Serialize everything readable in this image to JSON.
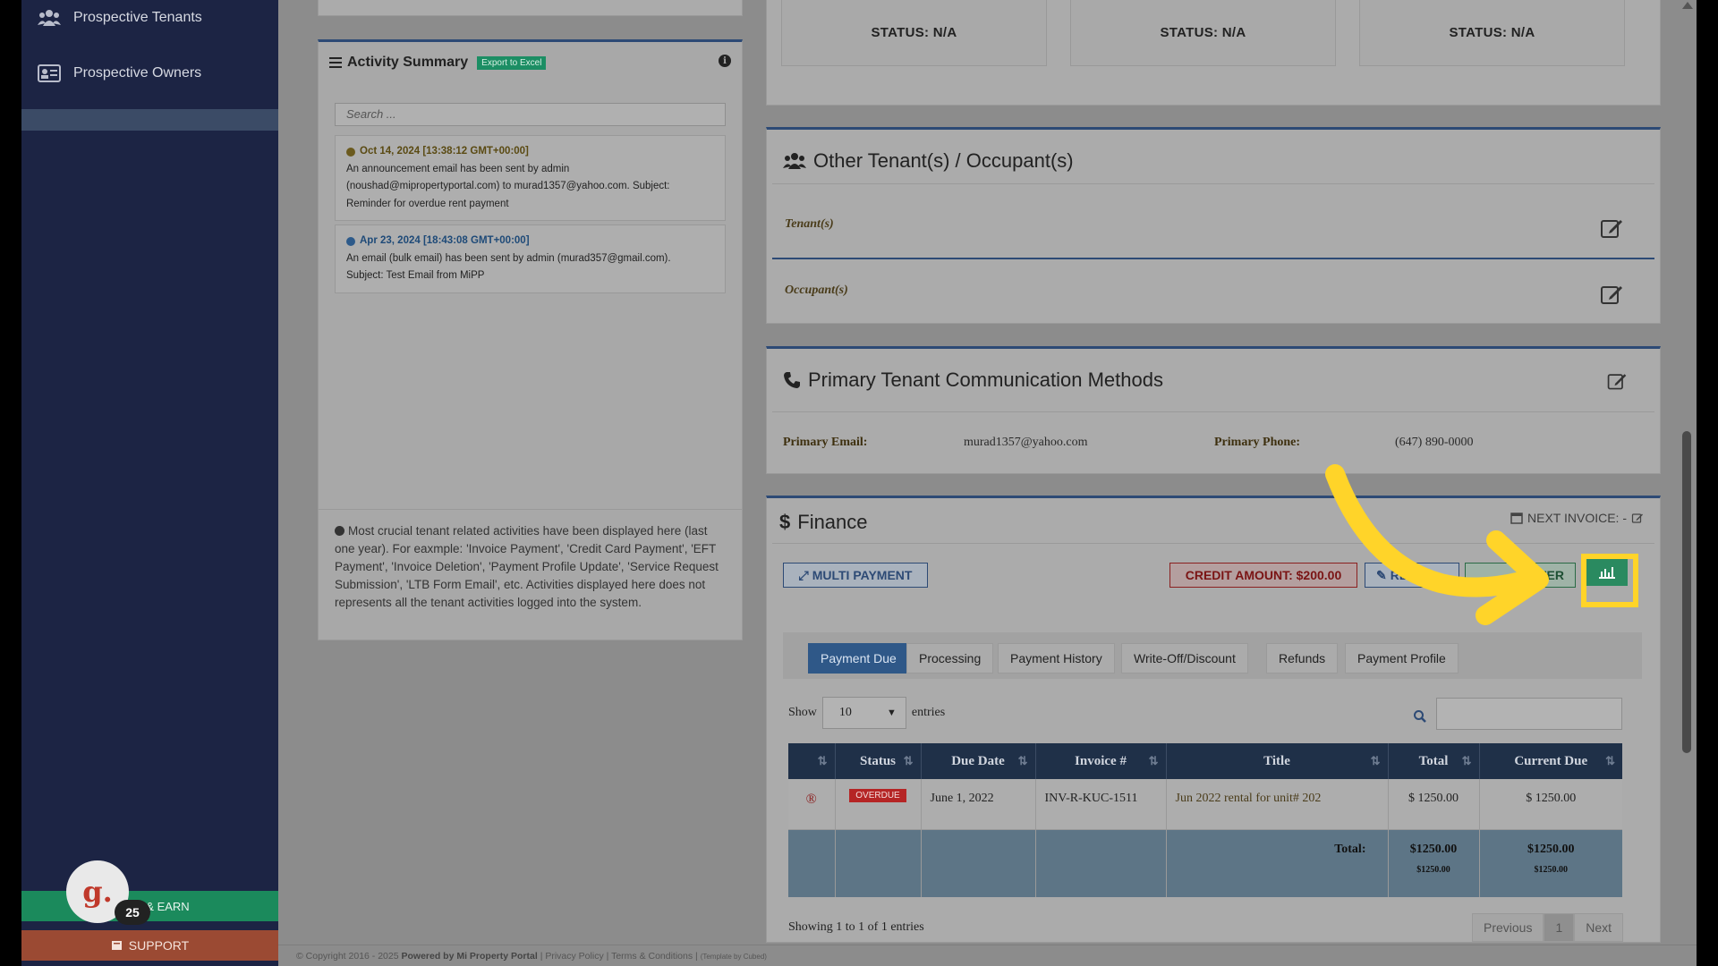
{
  "sidebar": {
    "items": [
      {
        "label": "Prospective Tenants",
        "icon": "users-icon"
      },
      {
        "label": "Prospective Owners",
        "icon": "id-card-icon"
      }
    ],
    "refer_label": "& EARN",
    "support_label": "SUPPORT",
    "notification_letter": "g.",
    "notification_count": "25"
  },
  "statuses": [
    "STATUS: N/A",
    "STATUS: N/A",
    "STATUS: N/A"
  ],
  "activity": {
    "title": "Activity Summary",
    "export_label": "Export to Excel",
    "search_placeholder": "Search ...",
    "items": [
      {
        "date": "Oct 14, 2024 [13:38:12 GMT+00:00]",
        "dot_color": "#6b5a1e",
        "line1": "An announcement email has been sent by admin",
        "line2": "(noushad@mipropertyportal.com) to murad1357@yahoo.com. Subject:",
        "line3": "Reminder for overdue rent payment"
      },
      {
        "date": "Apr 23, 2024 [18:43:08 GMT+00:00]",
        "dot_color": "#2d5a8a",
        "line1": "An email (bulk email) has been sent by admin (murad357@gmail.com).",
        "line2": "Subject: Test Email from MiPP"
      }
    ],
    "note": "Most crucial tenant related activities have been displayed here (last one year). For eaxmple: 'Invoice Payment', 'Credit Card Payment', 'EFT Payment', 'Invoice Deletion', 'Payment Profile Update', 'Service Request Submission', 'LTB Form Email', etc. Activities displayed here does not represents all the tenant activities logged into the system."
  },
  "tenants": {
    "title": "Other Tenant(s) / Occupant(s)",
    "tenant_label": "Tenant(s)",
    "occupant_label": "Occupant(s)"
  },
  "communication": {
    "title": "Primary Tenant Communication Methods",
    "email_label": "Primary Email:",
    "email_value": "murad1357@yahoo.com",
    "phone_label": "Primary Phone:",
    "phone_value": "(647) 890-0000"
  },
  "finance": {
    "title": "Finance",
    "next_invoice": "NEXT INVOICE: -",
    "multi_payment": "MULTI PAYMENT",
    "credit_amount": "CREDIT AMOUNT: $200.00",
    "return_label": "RETUR",
    "offer_label": "FER",
    "tabs": [
      "Payment Due",
      "Processing",
      "Payment History",
      "Write-Off/Discount",
      "Refunds",
      "Payment Profile"
    ],
    "show_label": "Show",
    "entries_value": "10",
    "entries_label": "entries",
    "table": {
      "headers": [
        "",
        "Status",
        "Due Date",
        "Invoice #",
        "Title",
        "Total",
        "Current Due"
      ],
      "row": {
        "status": "OVERDUE",
        "due_date": "June 1, 2022",
        "invoice": "INV-R-KUC-1511",
        "title": "Jun 2022 rental for unit# 202",
        "total": "$ 1250.00",
        "current_due": "$ 1250.00"
      },
      "total_label": "Total:",
      "total_value": "$1250.00",
      "total_sub": "$1250.00",
      "due_value": "$1250.00",
      "due_sub": "$1250.00"
    },
    "showing": "Showing 1 to 1 of 1 entries",
    "prev": "Previous",
    "page": "1",
    "next": "Next"
  },
  "footer": {
    "copyright": "© Copyright 2016 - 2025",
    "powered": "Powered by Mi Property Portal",
    "privacy": "Privacy Policy",
    "terms": "Terms & Conditions",
    "template": "(Template by Cubed)"
  },
  "colors": {
    "sidebar": "#1c2444",
    "accent_blue": "#2d4a75",
    "highlight": "#ffd429",
    "overdue": "#b52525"
  }
}
